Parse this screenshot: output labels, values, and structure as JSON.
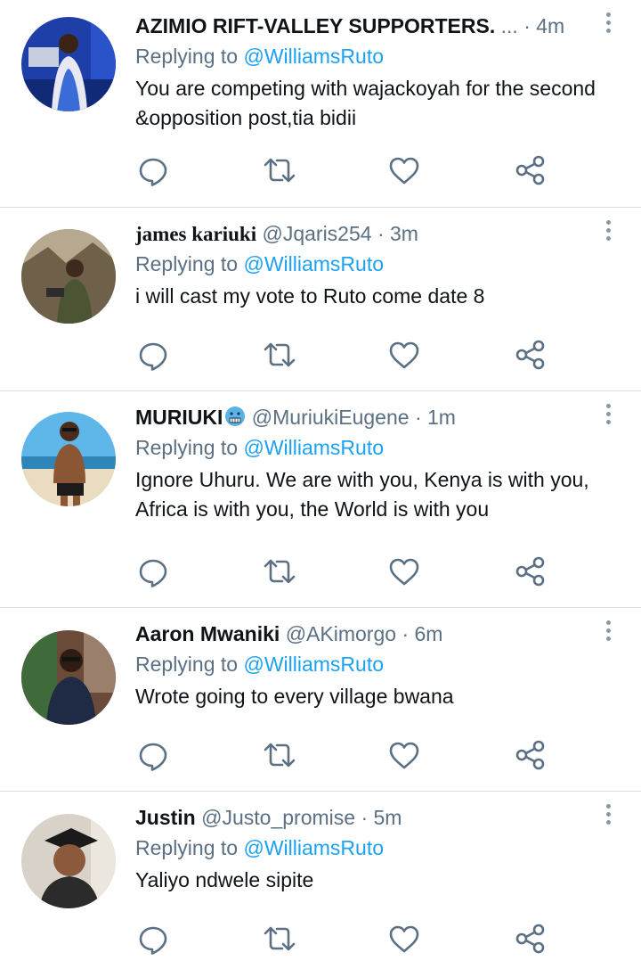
{
  "colors": {
    "name": "#0f1419",
    "secondary": "#5b7083",
    "mention": "#1da1f2",
    "divider": "#d9dee2"
  },
  "tweets": [
    {
      "name": "AZIMIO RIFT-VALLEY SUPPORTERS.",
      "name_ellipsis": "...",
      "handle": "",
      "dot": "·",
      "time": "4m",
      "replying_prefix": "Replying to",
      "replying_to": "@WilliamsRuto",
      "text": "You are competing with wajackoyah for the second &opposition post,tia bidii"
    },
    {
      "name": "james kariuki",
      "handle": "@Jqaris254",
      "dot": "·",
      "time": "3m",
      "replying_prefix": "Replying to",
      "replying_to": "@WilliamsRuto",
      "text": "i will cast my vote to Ruto come date 8"
    },
    {
      "name": "MURIUKI",
      "name_emoji": "cold-face-emoji",
      "handle": "@MuriukiEugene",
      "dot": "·",
      "time": "1m",
      "replying_prefix": "Replying to",
      "replying_to": "@WilliamsRuto",
      "text": "Ignore Uhuru. We are with you, Kenya is with you, Africa is with you, the World is with you"
    },
    {
      "name": "Aaron Mwaniki",
      "handle": "@AKimorgo",
      "dot": "·",
      "time": "6m",
      "replying_prefix": "Replying to",
      "replying_to": "@WilliamsRuto",
      "text": "Wrote going to every village bwana"
    },
    {
      "name": "Justin",
      "handle": "@Justo_promise",
      "dot": "·",
      "time": "5m",
      "replying_prefix": "Replying to",
      "replying_to": "@WilliamsRuto",
      "text": "Yaliyo ndwele sipite"
    }
  ],
  "action_icons": [
    "reply-icon",
    "retweet-icon",
    "like-icon",
    "share-icon"
  ]
}
